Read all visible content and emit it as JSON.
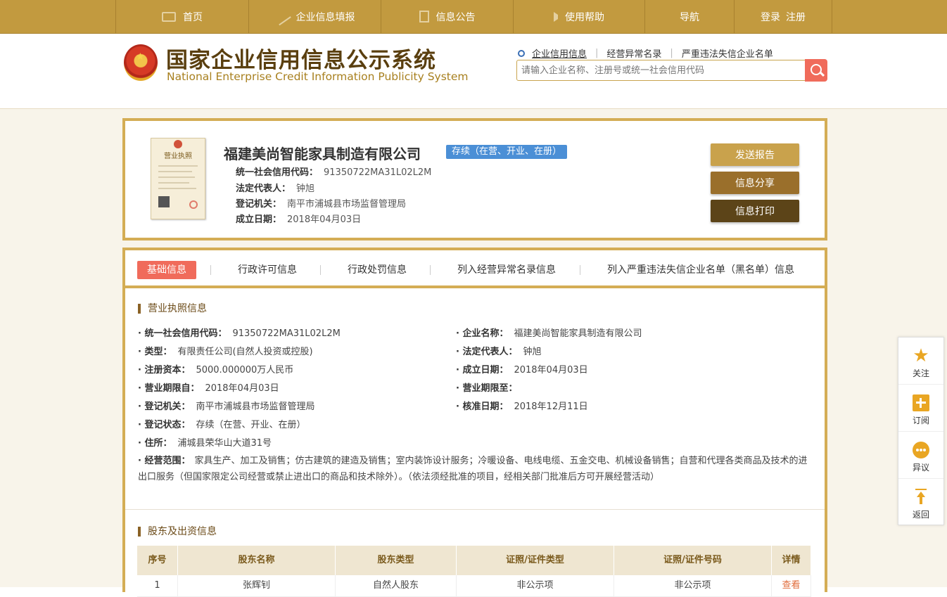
{
  "topnav": {
    "items": [
      {
        "label": "首页",
        "icon": "monitor-icon"
      },
      {
        "label": "企业信息填报",
        "icon": "pen-icon"
      },
      {
        "label": "信息公告",
        "icon": "document-icon"
      },
      {
        "label": "使用帮助",
        "icon": "speaker-icon"
      },
      {
        "label": "导航"
      }
    ],
    "login": "登录",
    "register": "注册"
  },
  "header": {
    "title": "国家企业信用信息公示系统",
    "subtitle": "National Enterprise Credit Information Publicity System",
    "search_links": [
      "企业信用信息",
      "经营异常名录",
      "严重违法失信企业名单"
    ],
    "search_placeholder": "请输入企业名称、注册号或统一社会信用代码"
  },
  "company": {
    "license_image_title": "营业执照",
    "name": "福建美尚智能家具制造有限公司",
    "status": "存续（在营、开业、在册）",
    "fields": [
      {
        "label": "统一社会信用代码：",
        "value": "91350722MA31L02L2M"
      },
      {
        "label": "法定代表人：",
        "value": "钟旭"
      },
      {
        "label": "登记机关：",
        "value": "南平市浦城县市场监督管理局"
      },
      {
        "label": "成立日期：",
        "value": "2018年04月03日"
      }
    ],
    "actions": [
      "发送报告",
      "信息分享",
      "信息打印"
    ]
  },
  "tabs": [
    "基础信息",
    "行政许可信息",
    "行政处罚信息",
    "列入经营异常名录信息",
    "列入严重违法失信企业名单（黑名单）信息"
  ],
  "license_section": {
    "title": "营业执照信息",
    "left": [
      {
        "label": "· 统一社会信用代码：",
        "value": "91350722MA31L02L2M"
      },
      {
        "label": "· 类型：",
        "value": "有限责任公司(自然人投资或控股)"
      },
      {
        "label": "· 注册资本：",
        "value": "5000.000000万人民币"
      },
      {
        "label": "· 营业期限自：",
        "value": "2018年04月03日"
      },
      {
        "label": "· 登记机关：",
        "value": "南平市浦城县市场监督管理局"
      },
      {
        "label": "· 登记状态：",
        "value": "存续（在营、开业、在册）"
      },
      {
        "label": "· 住所：",
        "value": "浦城县荣华山大道31号"
      }
    ],
    "right": [
      {
        "label": "· 企业名称：",
        "value": "福建美尚智能家具制造有限公司"
      },
      {
        "label": "· 法定代表人：",
        "value": "钟旭"
      },
      {
        "label": "· 成立日期：",
        "value": "2018年04月03日"
      },
      {
        "label": "· 营业期限至：",
        "value": ""
      },
      {
        "label": "· 核准日期：",
        "value": "2018年12月11日"
      }
    ],
    "scope_label": "· 经营范围：",
    "scope_value": "家具生产、加工及销售；仿古建筑的建造及销售；室内装饰设计服务；冷暖设备、电线电缆、五金交电、机械设备销售；自营和代理各类商品及技术的进出口服务（但国家限定公司经营或禁止进出口的商品和技术除外）。（依法须经批准的项目，经相关部门批准后方可开展经营活动）"
  },
  "shareholder_section": {
    "title": "股东及出资信息",
    "columns": [
      "序号",
      "股东名称",
      "股东类型",
      "证照/证件类型",
      "证照/证件号码",
      "详情"
    ],
    "rows": [
      [
        "1",
        "张辉钊",
        "自然人股东",
        "非公示项",
        "非公示项",
        "查看"
      ]
    ]
  },
  "sidebar": {
    "items": [
      {
        "label": "关注",
        "icon": "star-icon"
      },
      {
        "label": "订阅",
        "icon": "subscribe-icon"
      },
      {
        "label": "异议",
        "icon": "chat-icon"
      },
      {
        "label": "返回",
        "icon": "back-to-top-icon"
      }
    ]
  },
  "colors": {
    "nav_bg": "#c29a3f",
    "card_border": "#d4ad55",
    "accent_red": "#f06b5b",
    "status_blue": "#4b8fd6",
    "btn_send": "#c9a24c",
    "btn_share": "#9a6f2b",
    "btn_print": "#5c4418"
  }
}
